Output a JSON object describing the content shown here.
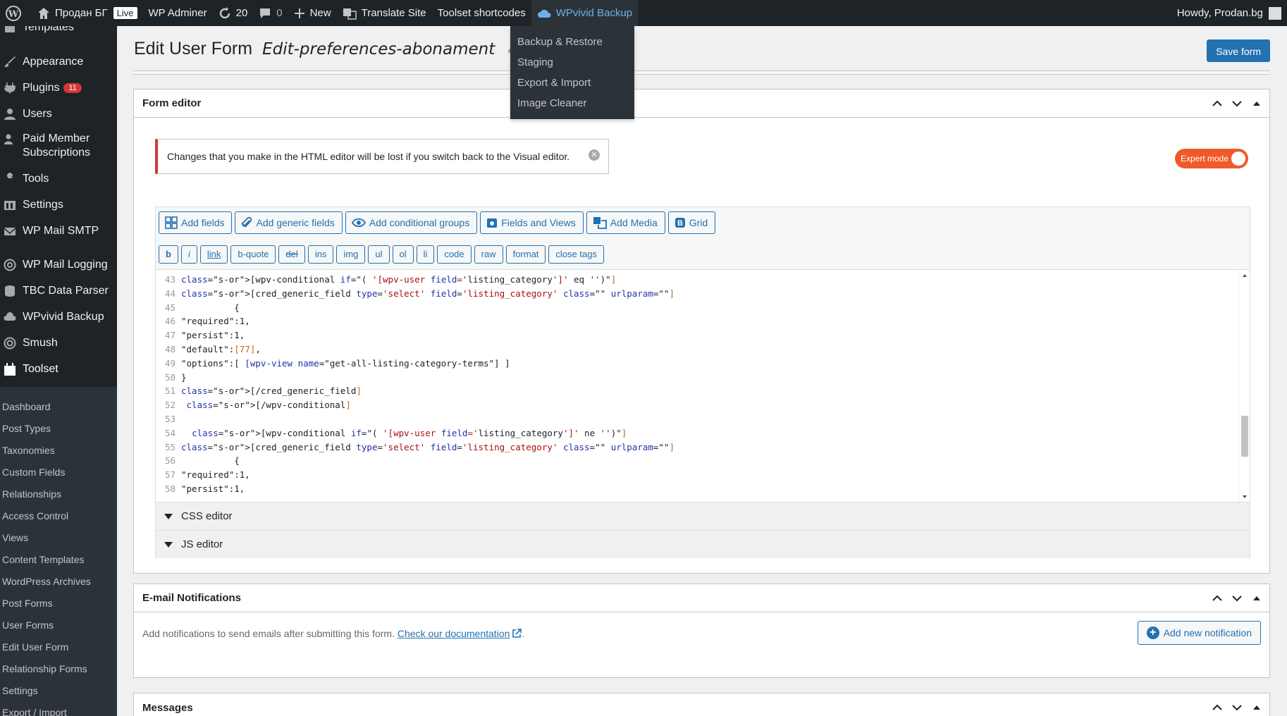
{
  "adminbar": {
    "site_name": "Продан БГ",
    "live_badge": "Live",
    "wp_adminer": "WP Adminer",
    "updates_count": "20",
    "comments_count": "0",
    "new_label": "New",
    "translate_site": "Translate Site",
    "toolset_shortcodes": "Toolset shortcodes",
    "wpvivid_backup": "WPvivid Backup",
    "howdy": "Howdy, Prodan.bg"
  },
  "dropdown": {
    "items": [
      "Backup & Restore",
      "Staging",
      "Export & Import",
      "Image Cleaner"
    ]
  },
  "sidebar": {
    "top_items": [
      {
        "label": "Templates",
        "icon": "templates-icon"
      },
      {
        "label": "Appearance",
        "icon": "paintbrush-icon"
      },
      {
        "label": "Plugins",
        "icon": "plugin-icon",
        "badge": "11"
      },
      {
        "label": "Users",
        "icon": "users-icon"
      },
      {
        "label": "Paid Member Subscriptions",
        "icon": "members-icon"
      },
      {
        "label": "Tools",
        "icon": "wrench-icon"
      },
      {
        "label": "Settings",
        "icon": "settings-icon"
      },
      {
        "label": "WP Mail SMTP",
        "icon": "mail-icon"
      },
      {
        "label": "WP Mail Logging",
        "icon": "at-icon"
      },
      {
        "label": "TBC Data Parser",
        "icon": "database-icon"
      },
      {
        "label": "WPvivid Backup",
        "icon": "cloud-icon"
      },
      {
        "label": "Smush",
        "icon": "smush-icon"
      },
      {
        "label": "Toolset",
        "icon": "toolset-icon"
      }
    ],
    "submenu": [
      "Dashboard",
      "Post Types",
      "Taxonomies",
      "Custom Fields",
      "Relationships",
      "Access Control",
      "Views",
      "Content Templates",
      "WordPress Archives",
      "Post Forms",
      "User Forms",
      "Edit User Form",
      "Relationship Forms",
      "Settings",
      "Export / Import"
    ]
  },
  "page": {
    "title": "Edit User Form",
    "form_name": "Edit-preferences-abonament",
    "save_button": "Save form"
  },
  "form_editor": {
    "header": "Form editor",
    "notice": "Changes that you make in the HTML editor will be lost if you switch back to the Visual editor.",
    "expert_mode": "Expert mode",
    "toolbar": [
      "Add fields",
      "Add generic fields",
      "Add conditional groups",
      "Fields and Views",
      "Add Media",
      "Grid"
    ],
    "quicktags": [
      "b",
      "i",
      "link",
      "b-quote",
      "del",
      "ins",
      "img",
      "ul",
      "ol",
      "li",
      "code",
      "raw",
      "format",
      "close tags"
    ],
    "code_lines": [
      {
        "n": "43",
        "text": "[wpv-conditional if=\"( '[wpv-user field='listing_category']' eq '')\"]"
      },
      {
        "n": "44",
        "text": "[cred_generic_field type='select' field='listing_category' class=\"\" urlparam=\"\"]"
      },
      {
        "n": "45",
        "text": "          {"
      },
      {
        "n": "46",
        "text": "\"required\":1,"
      },
      {
        "n": "47",
        "text": "\"persist\":1,"
      },
      {
        "n": "48",
        "text": "\"default\":[77],"
      },
      {
        "n": "49",
        "text": "\"options\":[ [wpv-view name=\"get-all-listing-category-terms\"] ]"
      },
      {
        "n": "50",
        "text": "}"
      },
      {
        "n": "51",
        "text": "[/cred_generic_field]"
      },
      {
        "n": "52",
        "text": " [/wpv-conditional]"
      },
      {
        "n": "53",
        "text": ""
      },
      {
        "n": "54",
        "text": "  [wpv-conditional if=\"( '[wpv-user field='listing_category']' ne '')\"]"
      },
      {
        "n": "55",
        "text": "[cred_generic_field type='select' field='listing_category' class=\"\" urlparam=\"\"]"
      },
      {
        "n": "56",
        "text": "          {"
      },
      {
        "n": "57",
        "text": "\"required\":1,"
      },
      {
        "n": "58",
        "text": "\"persist\":1,"
      }
    ],
    "css_editor": "CSS editor",
    "js_editor": "JS editor"
  },
  "email": {
    "header": "E-mail Notifications",
    "text": "Add notifications to send emails after submitting this form.",
    "link": "Check our documentation",
    "add_button": "Add new notification"
  },
  "messages": {
    "header": "Messages"
  }
}
